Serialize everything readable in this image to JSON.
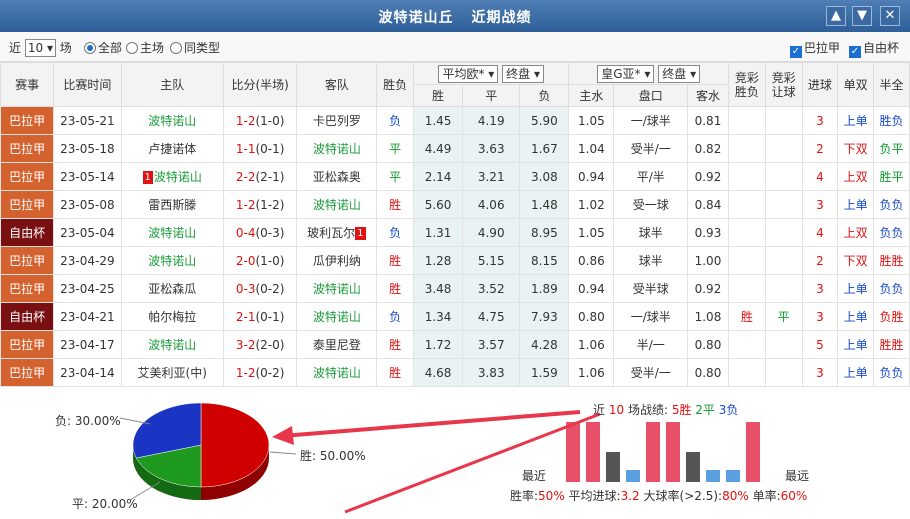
{
  "header": {
    "team": "波特诺山丘",
    "subtitle": "近期战绩",
    "up_icon": "arrow-up-icon",
    "down_icon": "arrow-down-icon",
    "close_icon": "close-icon"
  },
  "filter": {
    "prefix": "近",
    "count": "10",
    "suffix": "场",
    "radios": [
      {
        "label": "全部",
        "checked": true
      },
      {
        "label": "主场",
        "checked": false
      },
      {
        "label": "同类型",
        "checked": false
      }
    ],
    "checks": [
      {
        "label": "巴拉甲",
        "checked": true
      },
      {
        "label": "自由杯",
        "checked": true
      }
    ]
  },
  "columns": {
    "league": "赛事",
    "time": "比赛时间",
    "home": "主队",
    "score": "比分(半场)",
    "away": "客队",
    "result": "胜负",
    "eu_select": "平均欧*",
    "eu_mode": "终盘",
    "asia_select": "皇G亚*",
    "asia_mode": "终盘",
    "lottery_result": "竞彩胜负",
    "lottery_handicap": "竞彩让球",
    "goals": "进球",
    "oddeven": "单双",
    "halftime": "半全",
    "eu_sub": [
      "胜",
      "平",
      "负"
    ],
    "asia_sub": [
      "主水",
      "盘口",
      "客水"
    ]
  },
  "colors": {
    "league_bala": "#d3622e",
    "league_cup": "#7a0f12",
    "win": "#e01111",
    "draw": "#0d9b2e",
    "loss": "#1749c9",
    "pie_red": "#d00000",
    "pie_green": "#1e9a1e",
    "pie_blue": "#1a35c4",
    "bar_red": "#e8506a",
    "bar_dark": "#555555",
    "bar_blue": "#5aa0e0"
  },
  "rows": [
    {
      "league": "巴拉甲",
      "cup": false,
      "date": "23-05-21",
      "home": "波特诺山",
      "home_rank": "",
      "home_is_team": true,
      "score": "1-2",
      "half": "(1-0)",
      "away": "卡巴列罗",
      "away_rank": "",
      "away_is_team": false,
      "result": "负",
      "w": "1.45",
      "d": "4.19",
      "l": "5.90",
      "hw": "1.05",
      "hcp": "一/球半",
      "aw": "0.81",
      "lr": "",
      "lh": "",
      "goals": "3",
      "oe": "上单",
      "ht": "胜负"
    },
    {
      "league": "巴拉甲",
      "cup": false,
      "date": "23-05-18",
      "home": "卢捷诺体",
      "home_rank": "",
      "home_is_team": false,
      "score": "1-1",
      "half": "(0-1)",
      "away": "波特诺山",
      "away_rank": "",
      "away_is_team": true,
      "result": "平",
      "w": "4.49",
      "d": "3.63",
      "l": "1.67",
      "hw": "1.04",
      "hcp": "受半/一",
      "aw": "0.82",
      "lr": "",
      "lh": "",
      "goals": "2",
      "oe": "下双",
      "ht": "负平"
    },
    {
      "league": "巴拉甲",
      "cup": false,
      "date": "23-05-14",
      "home": "波特诺山",
      "home_rank": "1",
      "home_is_team": true,
      "score": "2-2",
      "half": "(2-1)",
      "away": "亚松森奥",
      "away_rank": "",
      "away_is_team": false,
      "result": "平",
      "w": "2.14",
      "d": "3.21",
      "l": "3.08",
      "hw": "0.94",
      "hcp": "平/半",
      "aw": "0.92",
      "lr": "",
      "lh": "",
      "goals": "4",
      "oe": "上双",
      "ht": "胜平"
    },
    {
      "league": "巴拉甲",
      "cup": false,
      "date": "23-05-08",
      "home": "雷西斯滕",
      "home_rank": "",
      "home_is_team": false,
      "score": "1-2",
      "half": "(1-2)",
      "away": "波特诺山",
      "away_rank": "",
      "away_is_team": true,
      "result": "胜",
      "w": "5.60",
      "d": "4.06",
      "l": "1.48",
      "hw": "1.02",
      "hcp": "受一球",
      "aw": "0.84",
      "lr": "",
      "lh": "",
      "goals": "3",
      "oe": "上单",
      "ht": "负负"
    },
    {
      "league": "自由杯",
      "cup": true,
      "date": "23-05-04",
      "home": "波特诺山",
      "home_rank": "",
      "home_is_team": true,
      "score": "0-4",
      "half": "(0-3)",
      "away": "玻利瓦尔",
      "away_rank": "1",
      "away_is_team": false,
      "result": "负",
      "w": "1.31",
      "d": "4.90",
      "l": "8.95",
      "hw": "1.05",
      "hcp": "球半",
      "aw": "0.93",
      "lr": "",
      "lh": "",
      "goals": "4",
      "oe": "上双",
      "ht": "负负"
    },
    {
      "league": "巴拉甲",
      "cup": false,
      "date": "23-04-29",
      "home": "波特诺山",
      "home_rank": "",
      "home_is_team": true,
      "score": "2-0",
      "half": "(1-0)",
      "away": "瓜伊利纳",
      "away_rank": "",
      "away_is_team": false,
      "result": "胜",
      "w": "1.28",
      "d": "5.15",
      "l": "8.15",
      "hw": "0.86",
      "hcp": "球半",
      "aw": "1.00",
      "lr": "",
      "lh": "",
      "goals": "2",
      "oe": "下双",
      "ht": "胜胜"
    },
    {
      "league": "巴拉甲",
      "cup": false,
      "date": "23-04-25",
      "home": "亚松森瓜",
      "home_rank": "",
      "home_is_team": false,
      "score": "0-3",
      "half": "(0-2)",
      "away": "波特诺山",
      "away_rank": "",
      "away_is_team": true,
      "result": "胜",
      "w": "3.48",
      "d": "3.52",
      "l": "1.89",
      "hw": "0.94",
      "hcp": "受半球",
      "aw": "0.92",
      "lr": "",
      "lh": "",
      "goals": "3",
      "oe": "上单",
      "ht": "负负"
    },
    {
      "league": "自由杯",
      "cup": true,
      "date": "23-04-21",
      "home": "帕尔梅拉",
      "home_rank": "",
      "home_is_team": false,
      "score": "2-1",
      "half": "(0-1)",
      "away": "波特诺山",
      "away_rank": "",
      "away_is_team": true,
      "result": "负",
      "w": "1.34",
      "d": "4.75",
      "l": "7.93",
      "hw": "0.80",
      "hcp": "一/球半",
      "aw": "1.08",
      "lr": "胜",
      "lh": "平",
      "goals": "3",
      "oe": "上单",
      "ht": "负胜"
    },
    {
      "league": "巴拉甲",
      "cup": false,
      "date": "23-04-17",
      "home": "波特诺山",
      "home_rank": "",
      "home_is_team": true,
      "score": "3-2",
      "half": "(2-0)",
      "away": "泰里尼登",
      "away_rank": "",
      "away_is_team": false,
      "result": "胜",
      "w": "1.72",
      "d": "3.57",
      "l": "4.28",
      "hw": "1.06",
      "hcp": "半/一",
      "aw": "0.80",
      "lr": "",
      "lh": "",
      "goals": "5",
      "oe": "上单",
      "ht": "胜胜"
    },
    {
      "league": "巴拉甲",
      "cup": false,
      "date": "23-04-14",
      "home": "艾美利亚(中)",
      "home_rank": "",
      "home_is_team": false,
      "score": "1-2",
      "half": "(0-2)",
      "away": "波特诺山",
      "away_rank": "",
      "away_is_team": true,
      "result": "胜",
      "w": "4.68",
      "d": "3.83",
      "l": "1.59",
      "hw": "1.06",
      "hcp": "受半/一",
      "aw": "0.80",
      "lr": "",
      "lh": "",
      "goals": "3",
      "oe": "上单",
      "ht": "负负"
    }
  ],
  "summary": {
    "recent_prefix": "近",
    "recent_count": "10",
    "recent_mid": "场战绩:",
    "wins": "5胜",
    "draws": "2平",
    "losses": "3负",
    "recent_label": "最近",
    "far_label": "最远",
    "win_rate_label": "胜率:",
    "win_rate": "50%",
    "avg_goals_label": "平均进球:",
    "avg_goals": "3.2",
    "over_label": "大球率(>2.5):",
    "over_rate": "80%",
    "odd_label": "单率:",
    "odd_rate": "60%"
  },
  "chart_data": [
    {
      "type": "pie",
      "slices": [
        {
          "label": "胜",
          "text": "胜: 50.00%",
          "value": 50
        },
        {
          "label": "平",
          "text": "平: 20.00%",
          "value": 20
        },
        {
          "label": "负",
          "text": "负: 30.00%",
          "value": 30
        }
      ]
    },
    {
      "type": "bar",
      "categories": [
        "1",
        "2",
        "3",
        "4",
        "5",
        "6",
        "7",
        "8",
        "9",
        "10"
      ],
      "values": [
        "胜",
        "胜",
        "平",
        "负",
        "胜",
        "胜",
        "平",
        "负",
        "负",
        "胜"
      ],
      "levels": [
        1,
        1,
        0.5,
        0.2,
        1,
        1,
        0.5,
        0.2,
        0.2,
        1
      ]
    }
  ]
}
